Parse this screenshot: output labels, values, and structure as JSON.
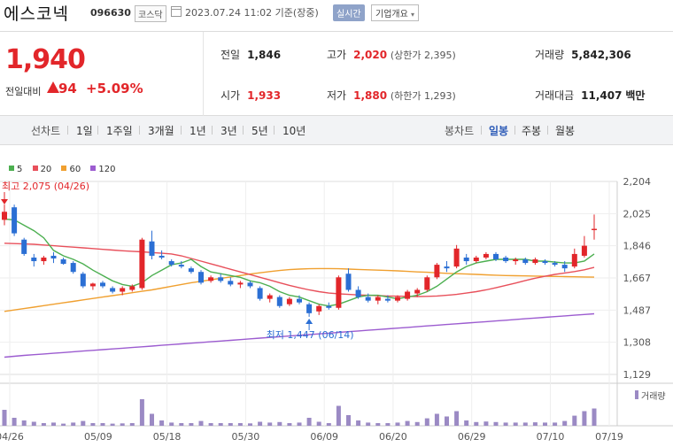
{
  "header": {
    "stock_name": "에스코넥",
    "stock_code": "096630",
    "market": "코스닥",
    "timestamp": "2023.07.24 11:02 기준(장중)",
    "realtime_label": "실시간",
    "company_info_label": "기업개요"
  },
  "price": {
    "current": "1,940",
    "change_label": "전일대비",
    "change_value": "94",
    "change_pct": "+5.09%"
  },
  "stats": {
    "prev_label": "전일",
    "prev_value": "1,846",
    "high_label": "고가",
    "high_value": "2,020",
    "upper_limit": "(상한가 2,395)",
    "volume_label": "거래량",
    "volume_value": "5,842,306",
    "open_label": "시가",
    "open_value": "1,933",
    "low_label": "저가",
    "low_value": "1,880",
    "lower_limit": "(하한가 1,293)",
    "amount_label": "거래대금",
    "amount_value": "11,407",
    "amount_unit": "백만"
  },
  "tabs": {
    "line_chart_label": "선차트",
    "line_periods": [
      "1일",
      "1주일",
      "3개월",
      "1년",
      "3년",
      "5년",
      "10년"
    ],
    "candle_label": "봉차트",
    "candle_periods": [
      "일봉",
      "주봉",
      "월봉"
    ],
    "active_candle": "일봉"
  },
  "colors": {
    "up": "#e2262a",
    "down": "#2b6fd4",
    "ma5": "#4caf50",
    "ma20": "#e8505b",
    "ma60": "#f0a030",
    "ma120": "#9c5cd0",
    "volume": "#9b8ac4"
  },
  "chart_data": {
    "type": "candlestick",
    "legend": [
      {
        "name": "5",
        "color": "#4caf50"
      },
      {
        "name": "20",
        "color": "#e8505b"
      },
      {
        "name": "60",
        "color": "#f0a030"
      },
      {
        "name": "120",
        "color": "#9c5cd0"
      }
    ],
    "y_ticks": [
      "2,204",
      "2,025",
      "1,846",
      "1,667",
      "1,487",
      "1,308",
      "1,129"
    ],
    "ylim": [
      1129,
      2204
    ],
    "x_ticks": [
      "04/26",
      "05/09",
      "05/18",
      "05/30",
      "06/09",
      "06/20",
      "06/29",
      "07/10",
      "07/19"
    ],
    "high_annotation": "최고 2,075 (04/26)",
    "low_annotation": "최저 1,447 (06/14)",
    "volume_label": "거래량",
    "candles": [
      {
        "o": 1990,
        "h": 2075,
        "l": 1960,
        "c": 2035
      },
      {
        "o": 2060,
        "h": 2075,
        "l": 1900,
        "c": 1915
      },
      {
        "o": 1880,
        "h": 1890,
        "l": 1790,
        "c": 1800
      },
      {
        "o": 1780,
        "h": 1800,
        "l": 1730,
        "c": 1760
      },
      {
        "o": 1760,
        "h": 1790,
        "l": 1740,
        "c": 1780
      },
      {
        "o": 1790,
        "h": 1810,
        "l": 1750,
        "c": 1775
      },
      {
        "o": 1770,
        "h": 1780,
        "l": 1740,
        "c": 1745
      },
      {
        "o": 1750,
        "h": 1760,
        "l": 1690,
        "c": 1700
      },
      {
        "o": 1690,
        "h": 1700,
        "l": 1610,
        "c": 1620
      },
      {
        "o": 1620,
        "h": 1640,
        "l": 1600,
        "c": 1635
      },
      {
        "o": 1640,
        "h": 1650,
        "l": 1610,
        "c": 1620
      },
      {
        "o": 1610,
        "h": 1620,
        "l": 1580,
        "c": 1590
      },
      {
        "o": 1590,
        "h": 1620,
        "l": 1570,
        "c": 1610
      },
      {
        "o": 1600,
        "h": 1630,
        "l": 1590,
        "c": 1620
      },
      {
        "o": 1610,
        "h": 1890,
        "l": 1600,
        "c": 1880
      },
      {
        "o": 1870,
        "h": 1930,
        "l": 1770,
        "c": 1790
      },
      {
        "o": 1790,
        "h": 1820,
        "l": 1770,
        "c": 1780
      },
      {
        "o": 1760,
        "h": 1770,
        "l": 1730,
        "c": 1740
      },
      {
        "o": 1740,
        "h": 1760,
        "l": 1720,
        "c": 1730
      },
      {
        "o": 1720,
        "h": 1730,
        "l": 1690,
        "c": 1700
      },
      {
        "o": 1700,
        "h": 1710,
        "l": 1630,
        "c": 1640
      },
      {
        "o": 1650,
        "h": 1680,
        "l": 1640,
        "c": 1670
      },
      {
        "o": 1670,
        "h": 1690,
        "l": 1640,
        "c": 1650
      },
      {
        "o": 1650,
        "h": 1670,
        "l": 1620,
        "c": 1630
      },
      {
        "o": 1630,
        "h": 1650,
        "l": 1610,
        "c": 1640
      },
      {
        "o": 1640,
        "h": 1650,
        "l": 1610,
        "c": 1620
      },
      {
        "o": 1610,
        "h": 1620,
        "l": 1540,
        "c": 1550
      },
      {
        "o": 1550,
        "h": 1580,
        "l": 1530,
        "c": 1570
      },
      {
        "o": 1560,
        "h": 1570,
        "l": 1500,
        "c": 1510
      },
      {
        "o": 1520,
        "h": 1560,
        "l": 1510,
        "c": 1550
      },
      {
        "o": 1550,
        "h": 1570,
        "l": 1520,
        "c": 1530
      },
      {
        "o": 1520,
        "h": 1530,
        "l": 1450,
        "c": 1470
      },
      {
        "o": 1480,
        "h": 1520,
        "l": 1460,
        "c": 1510
      },
      {
        "o": 1510,
        "h": 1530,
        "l": 1490,
        "c": 1500
      },
      {
        "o": 1500,
        "h": 1680,
        "l": 1490,
        "c": 1670
      },
      {
        "o": 1690,
        "h": 1720,
        "l": 1590,
        "c": 1600
      },
      {
        "o": 1600,
        "h": 1620,
        "l": 1550,
        "c": 1560
      },
      {
        "o": 1560,
        "h": 1580,
        "l": 1530,
        "c": 1540
      },
      {
        "o": 1540,
        "h": 1570,
        "l": 1520,
        "c": 1560
      },
      {
        "o": 1550,
        "h": 1570,
        "l": 1530,
        "c": 1540
      },
      {
        "o": 1540,
        "h": 1570,
        "l": 1530,
        "c": 1560
      },
      {
        "o": 1550,
        "h": 1600,
        "l": 1540,
        "c": 1590
      },
      {
        "o": 1580,
        "h": 1610,
        "l": 1560,
        "c": 1600
      },
      {
        "o": 1600,
        "h": 1680,
        "l": 1590,
        "c": 1670
      },
      {
        "o": 1670,
        "h": 1750,
        "l": 1660,
        "c": 1740
      },
      {
        "o": 1730,
        "h": 1760,
        "l": 1700,
        "c": 1720
      },
      {
        "o": 1730,
        "h": 1850,
        "l": 1720,
        "c": 1830
      },
      {
        "o": 1780,
        "h": 1800,
        "l": 1740,
        "c": 1760
      },
      {
        "o": 1760,
        "h": 1790,
        "l": 1750,
        "c": 1780
      },
      {
        "o": 1780,
        "h": 1810,
        "l": 1770,
        "c": 1800
      },
      {
        "o": 1800,
        "h": 1810,
        "l": 1760,
        "c": 1770
      },
      {
        "o": 1780,
        "h": 1790,
        "l": 1750,
        "c": 1760
      },
      {
        "o": 1760,
        "h": 1780,
        "l": 1740,
        "c": 1770
      },
      {
        "o": 1770,
        "h": 1780,
        "l": 1740,
        "c": 1750
      },
      {
        "o": 1750,
        "h": 1780,
        "l": 1740,
        "c": 1770
      },
      {
        "o": 1760,
        "h": 1770,
        "l": 1740,
        "c": 1750
      },
      {
        "o": 1750,
        "h": 1760,
        "l": 1730,
        "c": 1740
      },
      {
        "o": 1740,
        "h": 1760,
        "l": 1700,
        "c": 1720
      },
      {
        "o": 1730,
        "h": 1830,
        "l": 1720,
        "c": 1800
      },
      {
        "o": 1790,
        "h": 1900,
        "l": 1780,
        "c": 1846
      },
      {
        "o": 1933,
        "h": 2020,
        "l": 1880,
        "c": 1940
      }
    ],
    "ma5": [
      1995,
      1990,
      1960,
      1930,
      1890,
      1820,
      1790,
      1770,
      1745,
      1710,
      1680,
      1650,
      1630,
      1620,
      1640,
      1680,
      1710,
      1740,
      1750,
      1770,
      1730,
      1700,
      1690,
      1680,
      1670,
      1650,
      1640,
      1620,
      1590,
      1570,
      1560,
      1540,
      1520,
      1510,
      1520,
      1540,
      1560,
      1570,
      1570,
      1560,
      1550,
      1560,
      1570,
      1590,
      1620,
      1660,
      1700,
      1730,
      1750,
      1760,
      1770,
      1770,
      1770,
      1770,
      1760,
      1760,
      1755,
      1750,
      1750,
      1760,
      1800
    ],
    "ma20": [
      1860,
      1858,
      1856,
      1854,
      1850,
      1846,
      1842,
      1838,
      1834,
      1830,
      1826,
      1822,
      1818,
      1815,
      1812,
      1808,
      1804,
      1800,
      1790,
      1775,
      1760,
      1745,
      1730,
      1715,
      1700,
      1685,
      1670,
      1655,
      1640,
      1625,
      1612,
      1600,
      1590,
      1582,
      1578,
      1575,
      1572,
      1570,
      1568,
      1566,
      1565,
      1564,
      1563,
      1564,
      1566,
      1570,
      1575,
      1582,
      1590,
      1600,
      1612,
      1625,
      1638,
      1652,
      1665,
      1676,
      1686,
      1694,
      1702,
      1712,
      1725
    ],
    "ma60": [
      1480,
      1488,
      1496,
      1504,
      1512,
      1520,
      1528,
      1536,
      1544,
      1552,
      1560,
      1568,
      1576,
      1584,
      1592,
      1600,
      1610,
      1620,
      1630,
      1640,
      1648,
      1656,
      1664,
      1672,
      1680,
      1688,
      1695,
      1702,
      1708,
      1713,
      1716,
      1718,
      1719,
      1719,
      1718,
      1716,
      1714,
      1712,
      1710,
      1708,
      1706,
      1703,
      1700,
      1698,
      1695,
      1692,
      1690,
      1688,
      1686,
      1684,
      1682,
      1680,
      1679,
      1678,
      1677,
      1676,
      1675,
      1674,
      1673,
      1672,
      1671
    ],
    "ma120": [
      1225,
      1230,
      1235,
      1239,
      1243,
      1247,
      1251,
      1255,
      1259,
      1263,
      1267,
      1271,
      1275,
      1279,
      1283,
      1287,
      1291,
      1295,
      1299,
      1303,
      1307,
      1311,
      1315,
      1319,
      1323,
      1327,
      1331,
      1335,
      1339,
      1343,
      1347,
      1351,
      1355,
      1359,
      1363,
      1367,
      1371,
      1375,
      1379,
      1383,
      1387,
      1391,
      1395,
      1399,
      1403,
      1407,
      1411,
      1415,
      1419,
      1423,
      1427,
      1431,
      1435,
      1439,
      1443,
      1447,
      1451,
      1455,
      1459,
      1463,
      1467
    ],
    "volumes": [
      60,
      30,
      20,
      15,
      10,
      12,
      8,
      12,
      18,
      10,
      10,
      8,
      9,
      10,
      100,
      45,
      20,
      12,
      10,
      10,
      18,
      10,
      10,
      10,
      10,
      9,
      15,
      12,
      14,
      10,
      12,
      30,
      15,
      10,
      75,
      40,
      20,
      12,
      10,
      10,
      12,
      18,
      14,
      28,
      45,
      35,
      55,
      20,
      14,
      16,
      14,
      12,
      12,
      12,
      13,
      12,
      12,
      18,
      38,
      55,
      65
    ]
  }
}
